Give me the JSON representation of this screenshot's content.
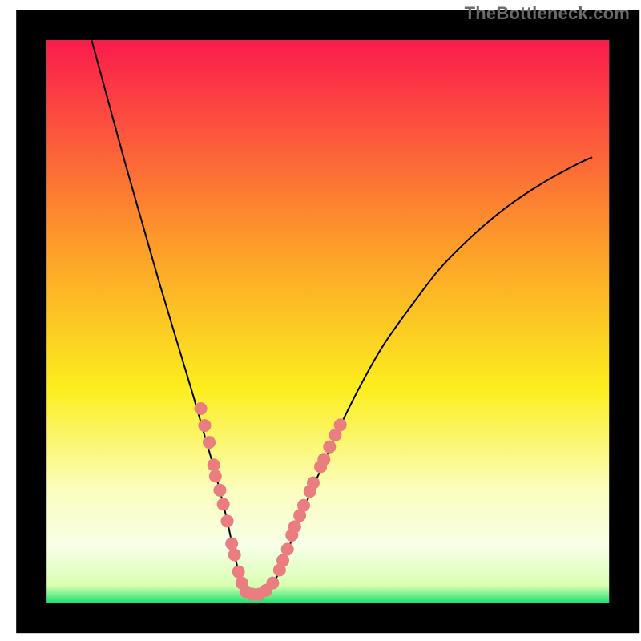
{
  "attribution": "TheBottleneck.com",
  "chart_data": {
    "type": "line",
    "title": "",
    "xlabel": "",
    "ylabel": "",
    "xlim": [
      0,
      100
    ],
    "ylim": [
      0,
      100
    ],
    "grid": false,
    "legend": false,
    "background": {
      "gradient_stops": [
        {
          "offset": 0.0,
          "color": "#fb1b4c"
        },
        {
          "offset": 0.36,
          "color": "#fd9b2a"
        },
        {
          "offset": 0.62,
          "color": "#fcee1e"
        },
        {
          "offset": 0.8,
          "color": "#fbfebd"
        },
        {
          "offset": 0.9,
          "color": "#f7ffe8"
        },
        {
          "offset": 0.97,
          "color": "#d8ffb0"
        },
        {
          "offset": 1.0,
          "color": "#19e36f"
        }
      ]
    },
    "frame": {
      "x": 4.9,
      "y": 3.9,
      "width": 92.5,
      "height": 92.5,
      "stroke": "#000000",
      "stroke_width_px": 38
    },
    "series": [
      {
        "name": "bottleneck-curve",
        "stroke": "#000000",
        "stroke_width_px": 2,
        "x": [
          8.0,
          11.0,
          14.0,
          17.0,
          20.0,
          23.0,
          26.0,
          28.0,
          30.0,
          32.0,
          33.5,
          35.0,
          36.0,
          38.0,
          40.0,
          42.0,
          45.0,
          48.0,
          52.0,
          56.0,
          60.0,
          65.0,
          70.0,
          76.0,
          82.0,
          88.0,
          94.0,
          97.0
        ],
        "y": [
          100.0,
          89.0,
          78.0,
          67.5,
          57.0,
          47.0,
          37.0,
          30.0,
          23.0,
          15.0,
          8.0,
          3.0,
          1.5,
          1.5,
          3.0,
          7.0,
          15.0,
          22.0,
          31.0,
          39.0,
          46.0,
          53.0,
          59.5,
          65.5,
          70.5,
          74.5,
          77.8,
          79.2
        ]
      }
    ],
    "markers": {
      "name": "cluster-dots",
      "fill": "#ea7d80",
      "radius_px": 8,
      "points": [
        {
          "x": 27.4,
          "y": 34.5
        },
        {
          "x": 28.1,
          "y": 31.5
        },
        {
          "x": 28.9,
          "y": 28.5
        },
        {
          "x": 29.7,
          "y": 24.5
        },
        {
          "x": 30.0,
          "y": 22.5
        },
        {
          "x": 30.8,
          "y": 20.0
        },
        {
          "x": 31.4,
          "y": 17.5
        },
        {
          "x": 32.1,
          "y": 14.5
        },
        {
          "x": 32.9,
          "y": 10.5
        },
        {
          "x": 33.4,
          "y": 8.5
        },
        {
          "x": 34.1,
          "y": 5.5
        },
        {
          "x": 34.7,
          "y": 3.5
        },
        {
          "x": 35.4,
          "y": 2.0
        },
        {
          "x": 36.6,
          "y": 1.5
        },
        {
          "x": 37.8,
          "y": 1.5
        },
        {
          "x": 39.0,
          "y": 2.2
        },
        {
          "x": 40.2,
          "y": 3.5
        },
        {
          "x": 41.4,
          "y": 5.8
        },
        {
          "x": 42.0,
          "y": 7.5
        },
        {
          "x": 42.8,
          "y": 9.5
        },
        {
          "x": 43.6,
          "y": 12.0
        },
        {
          "x": 44.1,
          "y": 13.5
        },
        {
          "x": 45.0,
          "y": 15.5
        },
        {
          "x": 45.7,
          "y": 17.3
        },
        {
          "x": 46.8,
          "y": 19.8
        },
        {
          "x": 47.4,
          "y": 21.3
        },
        {
          "x": 48.7,
          "y": 24.2
        },
        {
          "x": 49.3,
          "y": 25.5
        },
        {
          "x": 50.3,
          "y": 27.7
        },
        {
          "x": 51.3,
          "y": 29.8
        },
        {
          "x": 52.2,
          "y": 31.6
        }
      ]
    }
  }
}
